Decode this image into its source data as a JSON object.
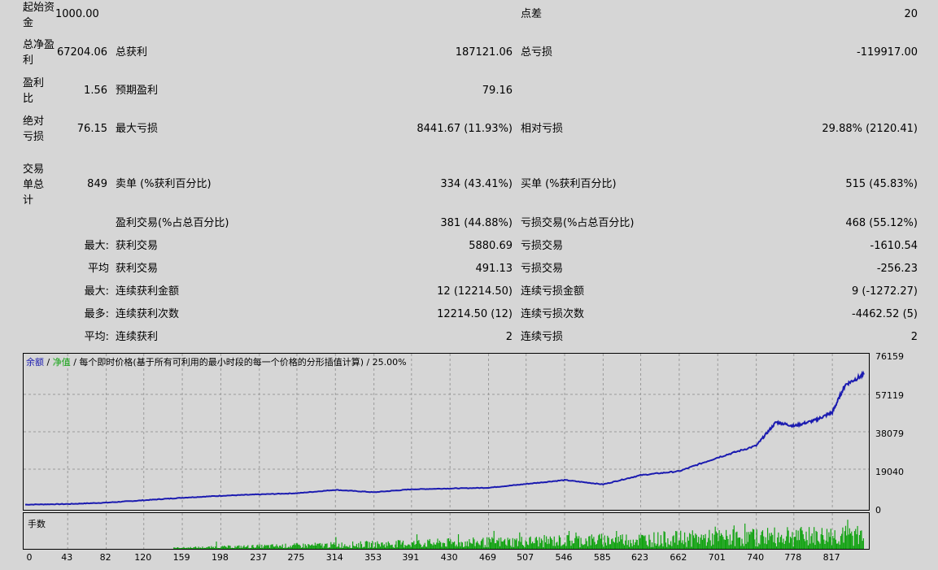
{
  "report": {
    "initial_deposit_label": "起始资金",
    "initial_deposit": "1000.00",
    "spread_label": "点差",
    "spread": "20",
    "net_profit_label": "总净盈利",
    "net_profit": "67204.06",
    "gross_profit_label": "总获利",
    "gross_profit": "187121.06",
    "gross_loss_label": "总亏损",
    "gross_loss": "-119917.00",
    "profit_factor_label": "盈利比",
    "profit_factor": "1.56",
    "expected_payoff_label": "预期盈利",
    "expected_payoff": "79.16",
    "abs_drawdown_label": "绝对亏损",
    "abs_drawdown": "76.15",
    "max_drawdown_label": "最大亏损",
    "max_drawdown": "8441.67 (11.93%)",
    "rel_drawdown_label": "相对亏损",
    "rel_drawdown": "29.88% (2120.41)",
    "total_trades_label": "交易单总计",
    "total_trades": "849",
    "short_label": "卖单 (%获利百分比)",
    "short_value": "334 (43.41%)",
    "long_label": "买单 (%获利百分比)",
    "long_value": "515 (45.83%)",
    "profit_trades_label": "盈利交易(%占总百分比)",
    "profit_trades": "381 (44.88%)",
    "loss_trades_label": "亏损交易(%占总百分比)",
    "loss_trades": "468 (55.12%)",
    "largest_prefix": "最大:",
    "largest_profit_label": "获利交易",
    "largest_profit": "5880.69",
    "largest_loss_label": "亏损交易",
    "largest_loss": "-1610.54",
    "average_prefix": "平均",
    "avg_profit_label": "获利交易",
    "avg_profit": "491.13",
    "avg_loss_label": "亏损交易",
    "avg_loss": "-256.23",
    "max_consec_prefix": "最大:",
    "max_consec_win_label": "连续获利金额",
    "max_consec_win": "12 (12214.50)",
    "max_consec_loss_label": "连续亏损金额",
    "max_consec_loss": "9 (-1272.27)",
    "maximal_prefix": "最多:",
    "maximal_consec_profit_label": "连续获利次数",
    "maximal_consec_profit": "12214.50 (12)",
    "maximal_consec_loss_label": "连续亏损次数",
    "maximal_consec_loss": "-4462.52 (5)",
    "avg_consec_prefix": "平均:",
    "avg_consec_win_label": "连续获利",
    "avg_consec_win": "2",
    "avg_consec_loss_label": "连续亏损",
    "avg_consec_loss": "2"
  },
  "chart": {
    "legend_balance": "余额",
    "legend_sep1": " / ",
    "legend_equity": "净值",
    "legend_rest": " / 每个即时价格(基于所有可利用的最小时段的每一个价格的分形插值计算) / 25.00%",
    "lots_label": "手数",
    "y_ticks": [
      "76159",
      "57119",
      "38079",
      "19040",
      "0"
    ],
    "x_ticks": [
      "0",
      "43",
      "82",
      "120",
      "159",
      "198",
      "237",
      "275",
      "314",
      "353",
      "391",
      "430",
      "469",
      "507",
      "546",
      "585",
      "623",
      "662",
      "701",
      "740",
      "778",
      "817"
    ]
  },
  "chart_data": {
    "type": "line",
    "ylim": [
      0,
      76159
    ],
    "xlim": [
      0,
      849
    ],
    "balance": {
      "x": [
        0,
        43,
        82,
        120,
        159,
        198,
        237,
        275,
        314,
        353,
        391,
        430,
        469,
        507,
        546,
        585,
        623,
        662,
        701,
        740,
        760,
        778,
        800,
        817,
        830,
        849
      ],
      "y": [
        1000,
        1300,
        2000,
        3200,
        4500,
        5500,
        6200,
        6800,
        8500,
        7300,
        8800,
        9200,
        9600,
        11500,
        13500,
        11300,
        16000,
        18000,
        25000,
        31000,
        43000,
        41000,
        44000,
        48000,
        62000,
        67204
      ]
    },
    "lots_color": "#12a312",
    "balance_color": "#1b1bb0"
  }
}
